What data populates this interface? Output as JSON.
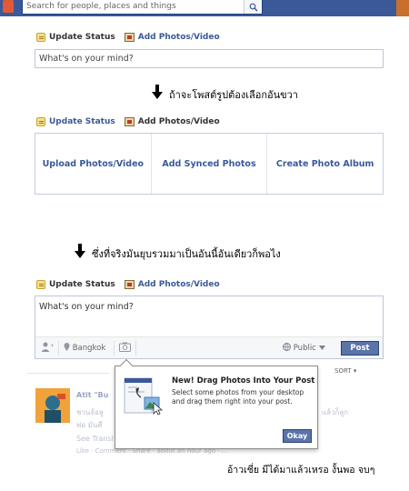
{
  "topbar": {
    "search_placeholder": "Search for people, places and things",
    "brand_color": "#3b5998"
  },
  "composer_tabs": {
    "update_status": "Update Status",
    "add_photos_video": "Add Photos/Video"
  },
  "composer1": {
    "placeholder": "What's on your mind?"
  },
  "annotation1": "ถ้าจะโพสต์รูปต้องเลือกอันขวา",
  "upload_options": [
    "Upload Photos/Video",
    "Add Synced Photos",
    "Create Photo Album"
  ],
  "annotation2": "ซึ่งที่จริงมันยุบรวมมาเป็นอันนี้อันเดียวก็พอไง",
  "composer2": {
    "placeholder": "What's on your mind?",
    "location": "Bangkok",
    "audience": "Public",
    "post_label": "Post"
  },
  "feed": {
    "sort_label": "SORT",
    "story_name": "Atit \"Bu",
    "story_line1": "ชวนจ้อลู",
    "story_line1_right": "แล้วก็ลูก",
    "story_line2": "พ่อ มันคื",
    "story_see_translation": "See Transl",
    "story_actions": "Like · Comment · Share · about an hour ago · ..."
  },
  "popup": {
    "title": "New! Drag Photos Into Your Post",
    "body": "Select some photos from your desktop and drag them right into your post.",
    "okay_label": "Okay"
  },
  "annotation3": "อ้าวเชี่ย มีได้มาแล้วเหรอ งั้นพอ จบๆ"
}
